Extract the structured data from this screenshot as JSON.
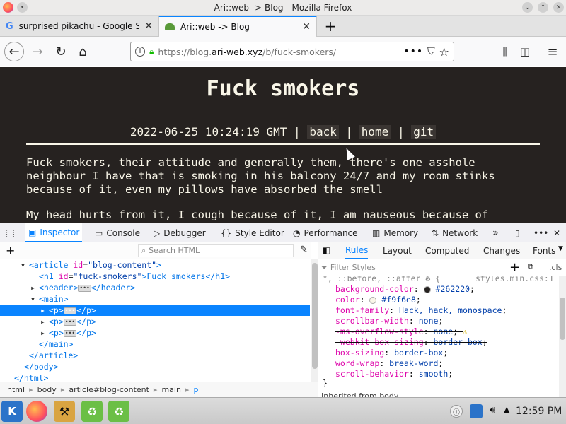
{
  "window": {
    "title": "Ari::web -> Blog - Mozilla Firefox"
  },
  "tabs": [
    {
      "label": "surprised pikachu - Google Se",
      "active": false
    },
    {
      "label": "Ari::web -> Blog",
      "active": true
    }
  ],
  "url": {
    "prefix": "https://blog.",
    "domain": "ari-web.xyz",
    "path": "/b/fuck-smokers/"
  },
  "page": {
    "title": "Fuck smokers",
    "date": "2022-06-25 10:24:19 GMT",
    "sep": "|",
    "links": [
      "back",
      "home",
      "git"
    ],
    "para1_lines": [
      "Fuck smokers, their attitude and generally them, there's one asshole",
      "neighbour I have that is smoking in his balcony 24/7 and my room stinks",
      "because of it, even my pillows have absorbed the smell"
    ],
    "para2": "My head hurts from it, I cough because of it, I am nauseous because of"
  },
  "devtools": {
    "tabs": [
      "Inspector",
      "Console",
      "Debugger",
      "Style Editor",
      "Performance",
      "Memory",
      "Network"
    ],
    "search_placeholder": "Search HTML",
    "tree": [
      {
        "indent": 3,
        "arrow": "▾",
        "t1": "<article ",
        "a": "id",
        "v": "\"blog-content\"",
        "t2": ">"
      },
      {
        "indent": 5,
        "arrow": "",
        "t1": "<h1 ",
        "a": "id",
        "v": "\"fuck-smokers\"",
        "t2": ">Fuck smokers</h1>"
      },
      {
        "indent": 5,
        "arrow": "▸",
        "t1": "<header>",
        "dots": true,
        "t2": "</header>"
      },
      {
        "indent": 5,
        "arrow": "▾",
        "t1": "<main>",
        "t2": ""
      },
      {
        "indent": 7,
        "arrow": "▸",
        "t1": "<p>",
        "dots": true,
        "t2": "</p>",
        "selected": true
      },
      {
        "indent": 7,
        "arrow": "▸",
        "t1": "<p>",
        "dots": true,
        "t2": "</p>"
      },
      {
        "indent": 7,
        "arrow": "▸",
        "t1": "<p>",
        "dots": true,
        "t2": "</p>"
      },
      {
        "indent": 5,
        "arrow": "",
        "t1": "</main>",
        "t2": ""
      },
      {
        "indent": 3,
        "arrow": "",
        "t1": "</article>",
        "t2": ""
      },
      {
        "indent": 2,
        "arrow": "",
        "t1": "</body>",
        "t2": ""
      },
      {
        "indent": 0,
        "arrow": "",
        "t1": "</html>",
        "t2": ""
      }
    ],
    "breadcrumbs": [
      "html",
      "body",
      "article#blog-content",
      "main",
      "p"
    ],
    "rule_tabs": [
      "Rules",
      "Layout",
      "Computed",
      "Changes",
      "Fonts"
    ],
    "filter_placeholder": "Filter Styles",
    "cls": ".cls",
    "selector": "*, ::before, ::after",
    "source": "styles.min.css:1",
    "rules": [
      {
        "p": "background-color",
        "v": "#262220",
        "swatch": "#262220"
      },
      {
        "p": "color",
        "v": "#f9f6e8",
        "swatch": "#f9f6e8"
      },
      {
        "p": "font-family",
        "v": "Hack, hack, monospace"
      },
      {
        "p": "scrollbar-width",
        "v": "none"
      },
      {
        "p": "-ms-overflow-style",
        "v": "none",
        "struck": true,
        "warn": true
      },
      {
        "p": "-webkit-box-sizing",
        "v": "border-box",
        "struck": true
      },
      {
        "p": "box-sizing",
        "v": "border-box"
      },
      {
        "p": "word-wrap",
        "v": "break-word"
      },
      {
        "p": "scroll-behavior",
        "v": "smooth"
      }
    ],
    "close_brace": "}",
    "inherited": "Inherited from body"
  },
  "taskbar": {
    "clock": "12:59 PM"
  },
  "colors": {
    "page_bg": "#262220",
    "page_fg": "#f9f6e8",
    "accent": "#0a84ff"
  }
}
